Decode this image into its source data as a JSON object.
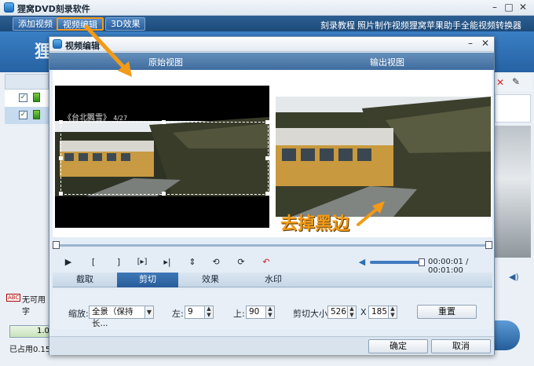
{
  "app": {
    "title": "狸窝DVD刻录软件",
    "tabs": [
      "添加视频",
      "视频编辑",
      "3D效果"
    ],
    "links": [
      "刻录教程",
      "照片制作视频",
      "狸窝苹果助手",
      "全能视频转换器"
    ],
    "banner_text": "狸",
    "status_label": "无可用字",
    "progress_value": "1.0",
    "usage_label": "已占用0.15"
  },
  "dialog": {
    "title": "视频编辑",
    "original_view_label": "原始视图",
    "output_view_label": "输出视图",
    "source_caption": "《台北飄雪》",
    "source_caption_page": "4/27",
    "annotation": "去掉黑边",
    "time_display": "00:00:01 / 00:01:00",
    "tabs": [
      "截取",
      "剪切",
      "效果",
      "水印"
    ],
    "active_tab": "剪切",
    "zoom_label": "缩放:",
    "zoom_value": "全景（保持长...",
    "left_label": "左:",
    "left_value": "9",
    "top_label": "上:",
    "top_value": "90",
    "crop_size_label": "剪切大小:",
    "crop_width": "526",
    "crop_x": "X",
    "crop_height": "185",
    "reset_label": "重置",
    "ok_label": "确定",
    "cancel_label": "取消"
  },
  "icons": {
    "play": "play-icon",
    "mark_in": "mark-in-icon",
    "mark_out": "mark-out-icon",
    "play_segment": "play-segment-icon",
    "next_frame": "next-frame-icon",
    "flip_vertical": "flip-vertical-icon",
    "rotate_left": "rotate-left-icon",
    "rotate_right": "rotate-right-icon",
    "undo": "undo-icon",
    "volume": "volume-icon"
  },
  "colors": {
    "accent_orange": "#f39a16",
    "header_blue": "#3f6c9e",
    "tab_active": "#285d99"
  }
}
